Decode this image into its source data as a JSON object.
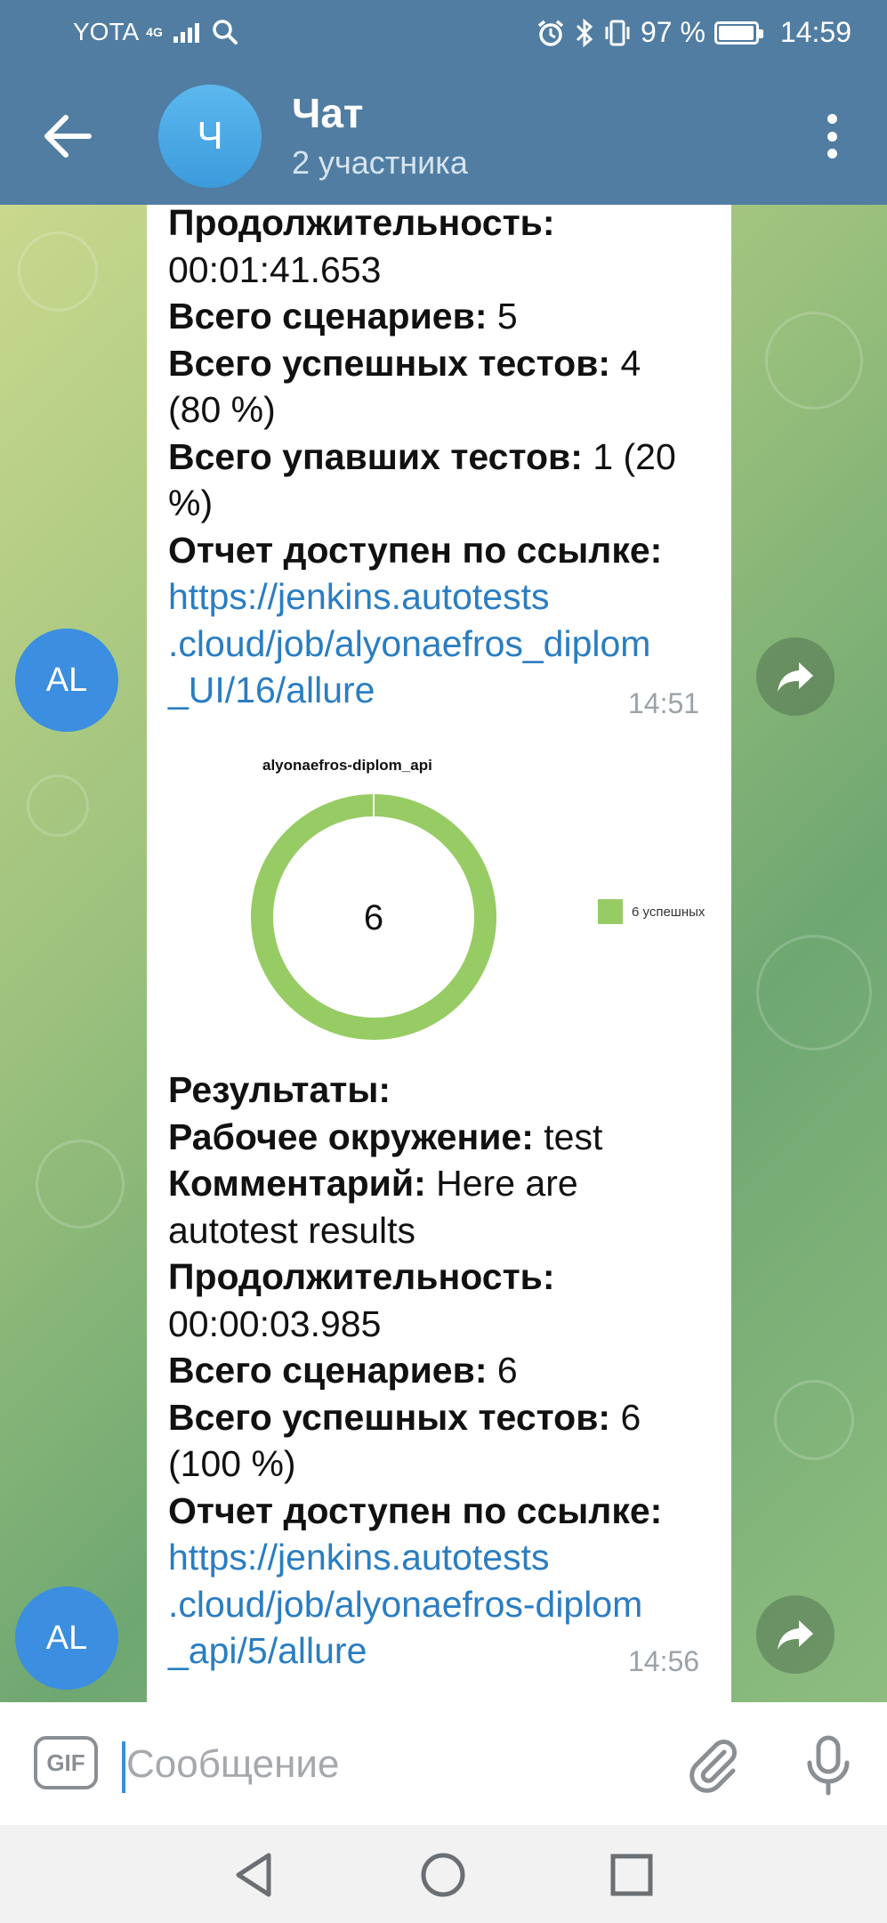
{
  "status_bar": {
    "carrier": "YOTA",
    "network": "4G",
    "battery": "97 %",
    "battery_level": 0.97,
    "time": "14:59"
  },
  "header": {
    "avatar_letter": "Ч",
    "title": "Чат",
    "subtitle": "2 участника"
  },
  "messages": [
    {
      "sender_initials": "AL",
      "lines": [
        {
          "label": "Продолжительность:",
          "value": ""
        },
        {
          "label": "",
          "value": "00:01:41.653"
        },
        {
          "label": "Всего сценариев:",
          "value": " 5"
        },
        {
          "label": "Всего успешных тестов:",
          "value": " 4"
        },
        {
          "label": "",
          "value": "(80 %)"
        },
        {
          "label": "Всего упавших тестов:",
          "value": " 1 (20"
        },
        {
          "label": "",
          "value": "%)"
        },
        {
          "label": "Отчет доступен по ссылке:",
          "value": ""
        }
      ],
      "link_lines": [
        "https://jenkins.autotests",
        ".cloud/job/alyonaefros_diplom",
        "_UI/16/allure"
      ],
      "time": "14:51"
    },
    {
      "sender_initials": "AL",
      "chart_title": "alyonaefros-diplom_api",
      "lines": [
        {
          "label": "Результаты:",
          "value": ""
        },
        {
          "label": "Рабочее окружение:",
          "value": " test"
        },
        {
          "label": "Комментарий:",
          "value": " Here are"
        },
        {
          "label": "",
          "value": "autotest results"
        },
        {
          "label": "Продолжительность:",
          "value": ""
        },
        {
          "label": "",
          "value": "00:00:03.985"
        },
        {
          "label": "Всего сценариев:",
          "value": " 6"
        },
        {
          "label": "Всего успешных тестов:",
          "value": " 6"
        },
        {
          "label": "",
          "value": "(100 %)"
        },
        {
          "label": "Отчет доступен по ссылке:",
          "value": ""
        }
      ],
      "link_lines": [
        "https://jenkins.autotests",
        ".cloud/job/alyonaefros-diplom",
        "_api/5/allure"
      ],
      "time": "14:56"
    }
  ],
  "chart_data": {
    "type": "pie",
    "title": "alyonaefros-diplom_api",
    "center_label": "6",
    "series": [
      {
        "name": "6 успешных",
        "values": [
          6
        ]
      }
    ],
    "categories": [
      "6 успешных"
    ],
    "colors": [
      "#97cc64"
    ],
    "legend": "right"
  },
  "input": {
    "gif_label": "GIF",
    "placeholder": "Сообщение"
  },
  "colors": {
    "header": "#517da2",
    "avatar": "#3b8ee0",
    "link": "#2a7dc2",
    "chart_green": "#97cc64"
  }
}
